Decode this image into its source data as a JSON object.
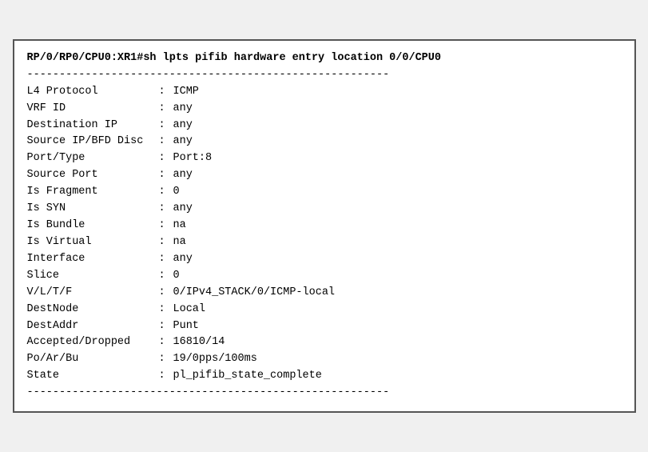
{
  "terminal": {
    "command": "RP/0/RP0/CPU0:XR1#sh lpts pifib hardware entry location 0/0/CPU0",
    "divider": "--------------------------------------------------------",
    "rows": [
      {
        "label": "L4 Protocol",
        "colon": ":",
        "value": "ICMP"
      },
      {
        "label": "VRF ID",
        "colon": ":",
        "value": "any"
      },
      {
        "label": "Destination IP",
        "colon": ":",
        "value": "any"
      },
      {
        "label": "Source IP/BFD Disc",
        "colon": ":",
        "value": "any"
      },
      {
        "label": "Port/Type",
        "colon": ":",
        "value": "Port:8"
      },
      {
        "label": "Source Port",
        "colon": ":",
        "value": "any"
      },
      {
        "label": "Is Fragment",
        "colon": ":",
        "value": "0"
      },
      {
        "label": "Is SYN",
        "colon": ":",
        "value": "any"
      },
      {
        "label": "Is Bundle",
        "colon": ":",
        "value": "na"
      },
      {
        "label": "Is Virtual",
        "colon": ":",
        "value": "na"
      },
      {
        "label": "Interface",
        "colon": ":",
        "value": "any"
      },
      {
        "label": "Slice",
        "colon": ":",
        "value": "0"
      },
      {
        "label": "V/L/T/F",
        "colon": ":",
        "value": "0/IPv4_STACK/0/ICMP-local"
      },
      {
        "label": "DestNode",
        "colon": ":",
        "value": "Local"
      },
      {
        "label": "DestAddr",
        "colon": ":",
        "value": "Punt"
      },
      {
        "label": "Accepted/Dropped",
        "colon": ":",
        "value": "16810/14"
      },
      {
        "label": "Po/Ar/Bu",
        "colon": ":",
        "value": "19/0pps/100ms"
      },
      {
        "label": "State",
        "colon": ":",
        "value": "pl_pifib_state_complete"
      }
    ]
  }
}
